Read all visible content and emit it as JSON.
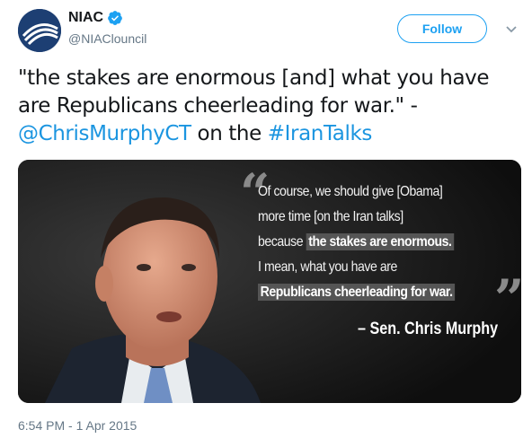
{
  "author": {
    "display_name": "NIAC",
    "handle": "@NIAClouncil",
    "verified": true,
    "avatar_color": "#1d3f73"
  },
  "header": {
    "follow_label": "Follow",
    "caret_icon": "chevron-down-icon"
  },
  "tweet": {
    "text_part1": "\"the stakes are enormous [and] what you have are Republicans cheerleading for war.\" - ",
    "mention": "@ChrisMurphyCT",
    "text_part2": " on the ",
    "hashtag": "#IranTalks",
    "link_color": "#1b95e0"
  },
  "media": {
    "quote": {
      "line1": "Of course, we should give [Obama]",
      "line2": "more time [on the Iran talks]",
      "line3_prefix": "because ",
      "line3_highlight": "the stakes are enormous.",
      "line4": "I mean, what you have are",
      "line5_highlight": "Republicans cheerleading for war.",
      "open_mark": "“",
      "close_mark": "”"
    },
    "attribution": "– Sen. Chris Murphy"
  },
  "footer": {
    "timestamp": "6:54 PM - 1 Apr 2015"
  }
}
